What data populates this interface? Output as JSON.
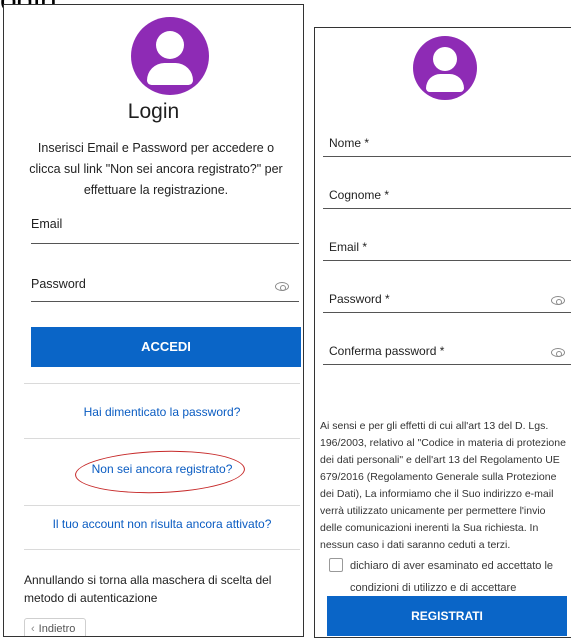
{
  "heading_fragment": "ogin",
  "login": {
    "title": "Login",
    "intro": "Inserisci Email e Password per accedere o clicca sul link \"Non sei ancora registrato?\" per effettuare la registrazione.",
    "email_label": "Email",
    "password_label": "Password",
    "submit_label": "ACCEDI",
    "forgot_link": "Hai dimenticato la password?",
    "register_link": "Non sei ancora registrato?",
    "not_activated_link": "Il tuo account non risulta ancora attivato?",
    "cancel_note": "Annullando si torna alla maschera di scelta del metodo di autenticazione",
    "back_label": "Indietro"
  },
  "register": {
    "name_label": "Nome *",
    "surname_label": "Cognome *",
    "email_label": "Email *",
    "password_label": "Password *",
    "confirm_label": "Conferma password *",
    "legal_text": "Ai sensi e per gli effetti di cui all'art 13 del D. Lgs. 196/2003, relativo al \"Codice in materia di protezione dei dati personali\" e dell'art 13 del Regolamento UE 679/2016 (Regolamento Generale sulla Protezione dei Dati), La informiamo che il Suo indirizzo e-mail verrà utilizzato unicamente per permettere l'invio delle comunicazioni inerenti la Sua richiesta. In nessun caso i dati saranno ceduti a terzi.",
    "consent_text": "dichiaro di aver esaminato ed accettato le condizioni di utilizzo e di accettare l'informativa",
    "submit_label": "REGISTRATI"
  },
  "colors": {
    "avatar": "#8e2bb5",
    "primary": "#0a65c7",
    "link": "#0a5cc2",
    "annotation": "#c62828"
  }
}
